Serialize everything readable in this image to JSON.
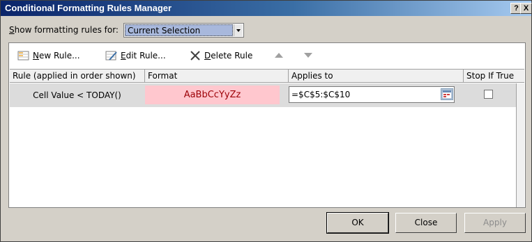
{
  "window": {
    "title": "Conditional Formatting Rules Manager",
    "help_label": "?",
    "close_label": "X"
  },
  "filter": {
    "label_accel": "S",
    "label_rest": "how formatting rules for:",
    "selected": "Current Selection"
  },
  "toolbar": {
    "new_rule_accel": "N",
    "new_rule_rest": "ew Rule...",
    "edit_rule_accel": "E",
    "edit_rule_rest": "dit Rule...",
    "delete_rule_accel": "D",
    "delete_rule_rest": "elete Rule"
  },
  "table": {
    "columns": [
      "Rule (applied in order shown)",
      "Format",
      "Applies to",
      "Stop If True"
    ],
    "rows": [
      {
        "rule": "Cell Value < TODAY()",
        "format_preview": "AaBbCcYyZz",
        "applies_to": "=$C$5:$C$10",
        "stop_if_true": false
      }
    ]
  },
  "buttons": {
    "ok": "OK",
    "close": "Close",
    "apply": "Apply"
  },
  "colors": {
    "format_fill": "#ffc7ce",
    "format_text": "#9c0006",
    "title_bar": "#0a246a"
  }
}
